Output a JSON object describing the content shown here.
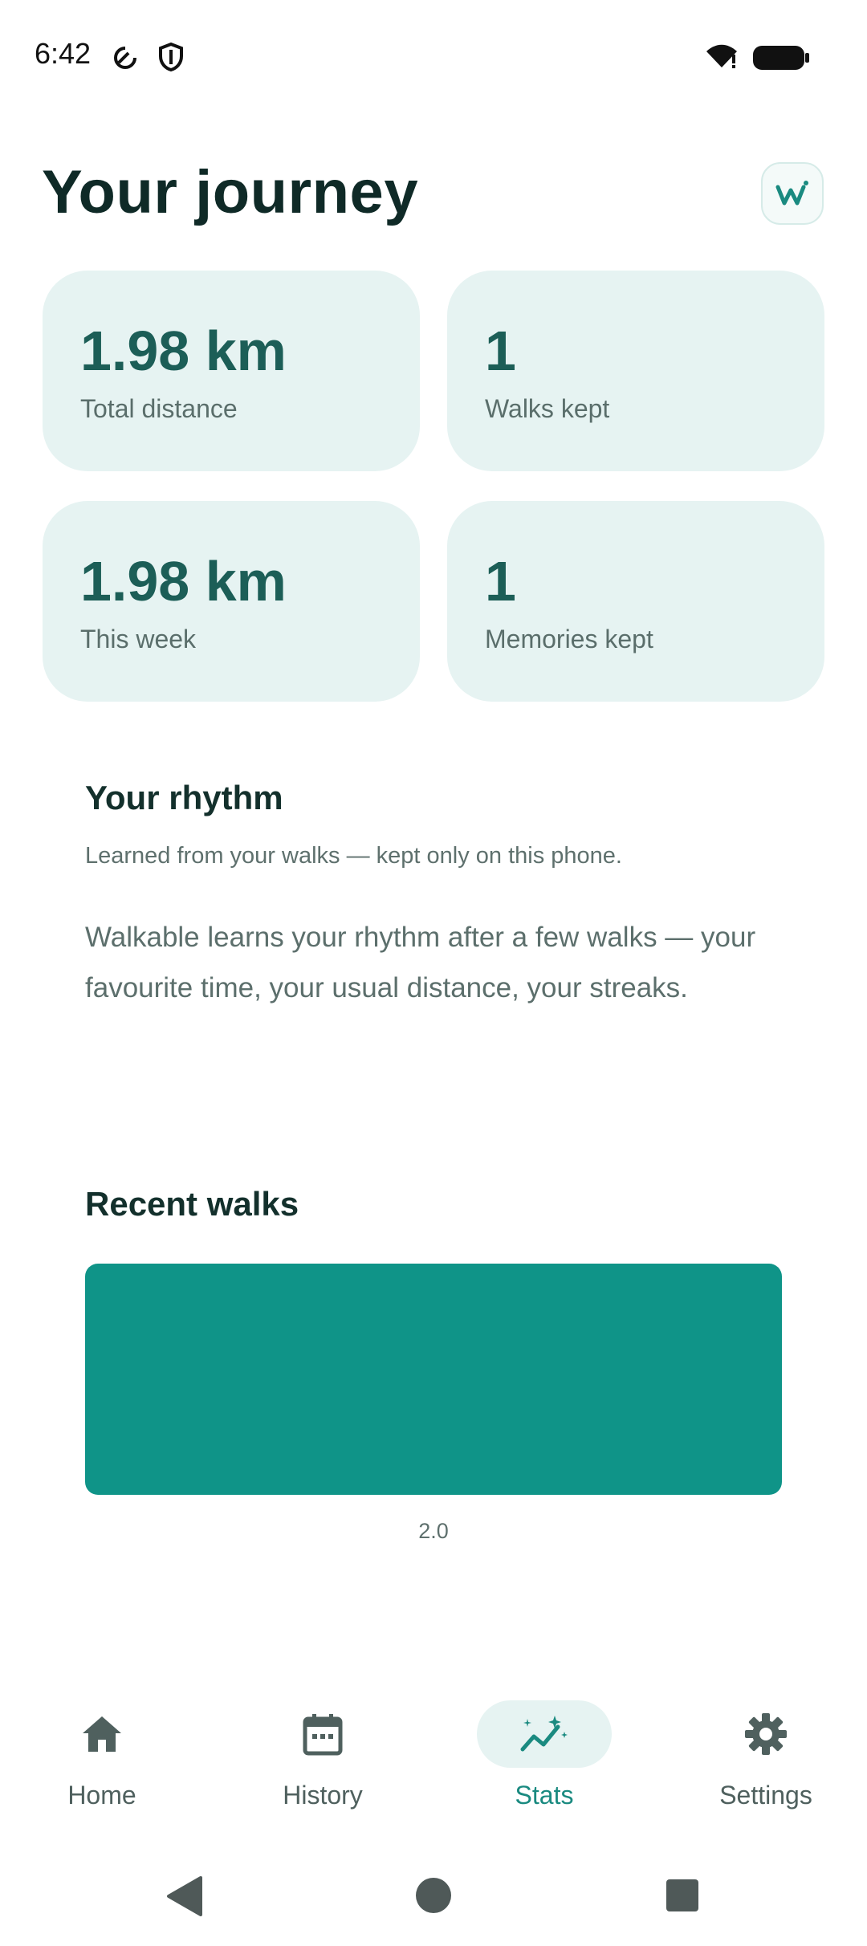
{
  "status_bar": {
    "time": "6:42",
    "icons": [
      "data-saver-icon",
      "shield-icon",
      "wifi-icon",
      "battery-icon"
    ]
  },
  "header": {
    "title": "Your journey",
    "logo_icon": "walkable-logo-icon"
  },
  "stats": {
    "total_distance": {
      "value": "1.98 km",
      "label": "Total distance"
    },
    "walks_kept": {
      "value": "1",
      "label": "Walks kept"
    },
    "this_week": {
      "value": "1.98 km",
      "label": "This week"
    },
    "memories_kept": {
      "value": "1",
      "label": "Memories kept"
    }
  },
  "rhythm": {
    "title": "Your rhythm",
    "subtitle": "Learned from your walks — kept only on this phone.",
    "body": "Walkable learns your rhythm after a few walks — your favourite time, your usual distance, your streaks."
  },
  "recent_walks": {
    "title": "Recent walks"
  },
  "chart_data": {
    "type": "bar",
    "categories": [
      "2.0"
    ],
    "values": [
      1.98
    ],
    "title": "",
    "xlabel": "",
    "ylabel": "",
    "bar_color": "#0f9488"
  },
  "bottom_nav": {
    "items": [
      {
        "label": "Home",
        "icon": "home-icon"
      },
      {
        "label": "History",
        "icon": "calendar-icon"
      },
      {
        "label": "Stats",
        "icon": "stats-sparkle-icon",
        "active": true
      },
      {
        "label": "Settings",
        "icon": "gear-icon"
      }
    ]
  },
  "colors": {
    "accent": "#1a8a80",
    "card_bg": "#e6f3f2",
    "bar": "#0f9488"
  }
}
